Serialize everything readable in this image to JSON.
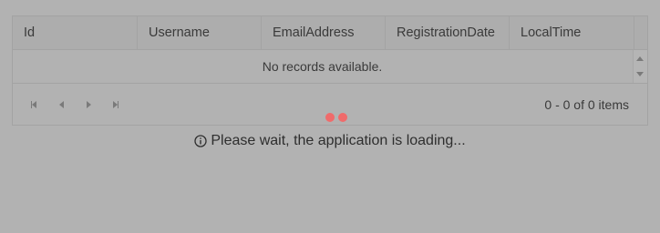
{
  "grid": {
    "columns": [
      {
        "label": "Id"
      },
      {
        "label": "Username"
      },
      {
        "label": "EmailAddress"
      },
      {
        "label": "RegistrationDate"
      },
      {
        "label": "LocalTime"
      }
    ],
    "empty_message": "No records available.",
    "pager": {
      "first_icon": "first-page-icon",
      "prev_icon": "previous-page-icon",
      "next_icon": "next-page-icon",
      "last_icon": "last-page-icon",
      "info": "0 - 0 of 0 items"
    }
  },
  "loading": {
    "message": "Please wait, the application is loading...",
    "icon": "info-icon",
    "dot_color": "#f06b6b"
  }
}
